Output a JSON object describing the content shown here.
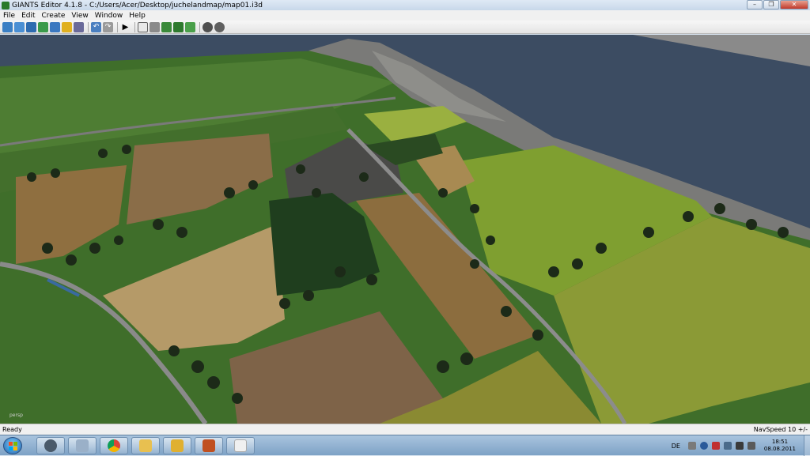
{
  "window": {
    "title": "GIANTS Editor 4.1.8 - C:/Users/Acer/Desktop/juchelandmap/map01.i3d",
    "controls": [
      "minimize",
      "maximize",
      "close"
    ]
  },
  "menu": {
    "items": [
      "File",
      "Edit",
      "Create",
      "View",
      "Window",
      "Help"
    ]
  },
  "toolbar": {
    "icons": [
      "new-icon",
      "open-icon",
      "save-icon",
      "save-as-icon",
      "export-icon",
      "import-icon",
      "print-icon",
      "undo-icon",
      "redo-icon",
      "play-icon",
      "select-mode-icon",
      "translate-icon",
      "terrain-paint-icon",
      "terrain-sculpt-icon",
      "foliage-paint-icon",
      "settings-icon",
      "refresh-icon"
    ]
  },
  "viewport": {
    "camera_label": "persp"
  },
  "statusbar": {
    "left": "Ready",
    "right": "NavSpeed 10 +/-"
  },
  "taskbar": {
    "apps": [
      "windows-start",
      "steam-icon",
      "calculator-icon",
      "chrome-icon",
      "explorer-icon",
      "mail-icon",
      "game-icon",
      "paint-icon"
    ],
    "language": "DE",
    "time": "18:51",
    "date": "08.08.2011"
  }
}
